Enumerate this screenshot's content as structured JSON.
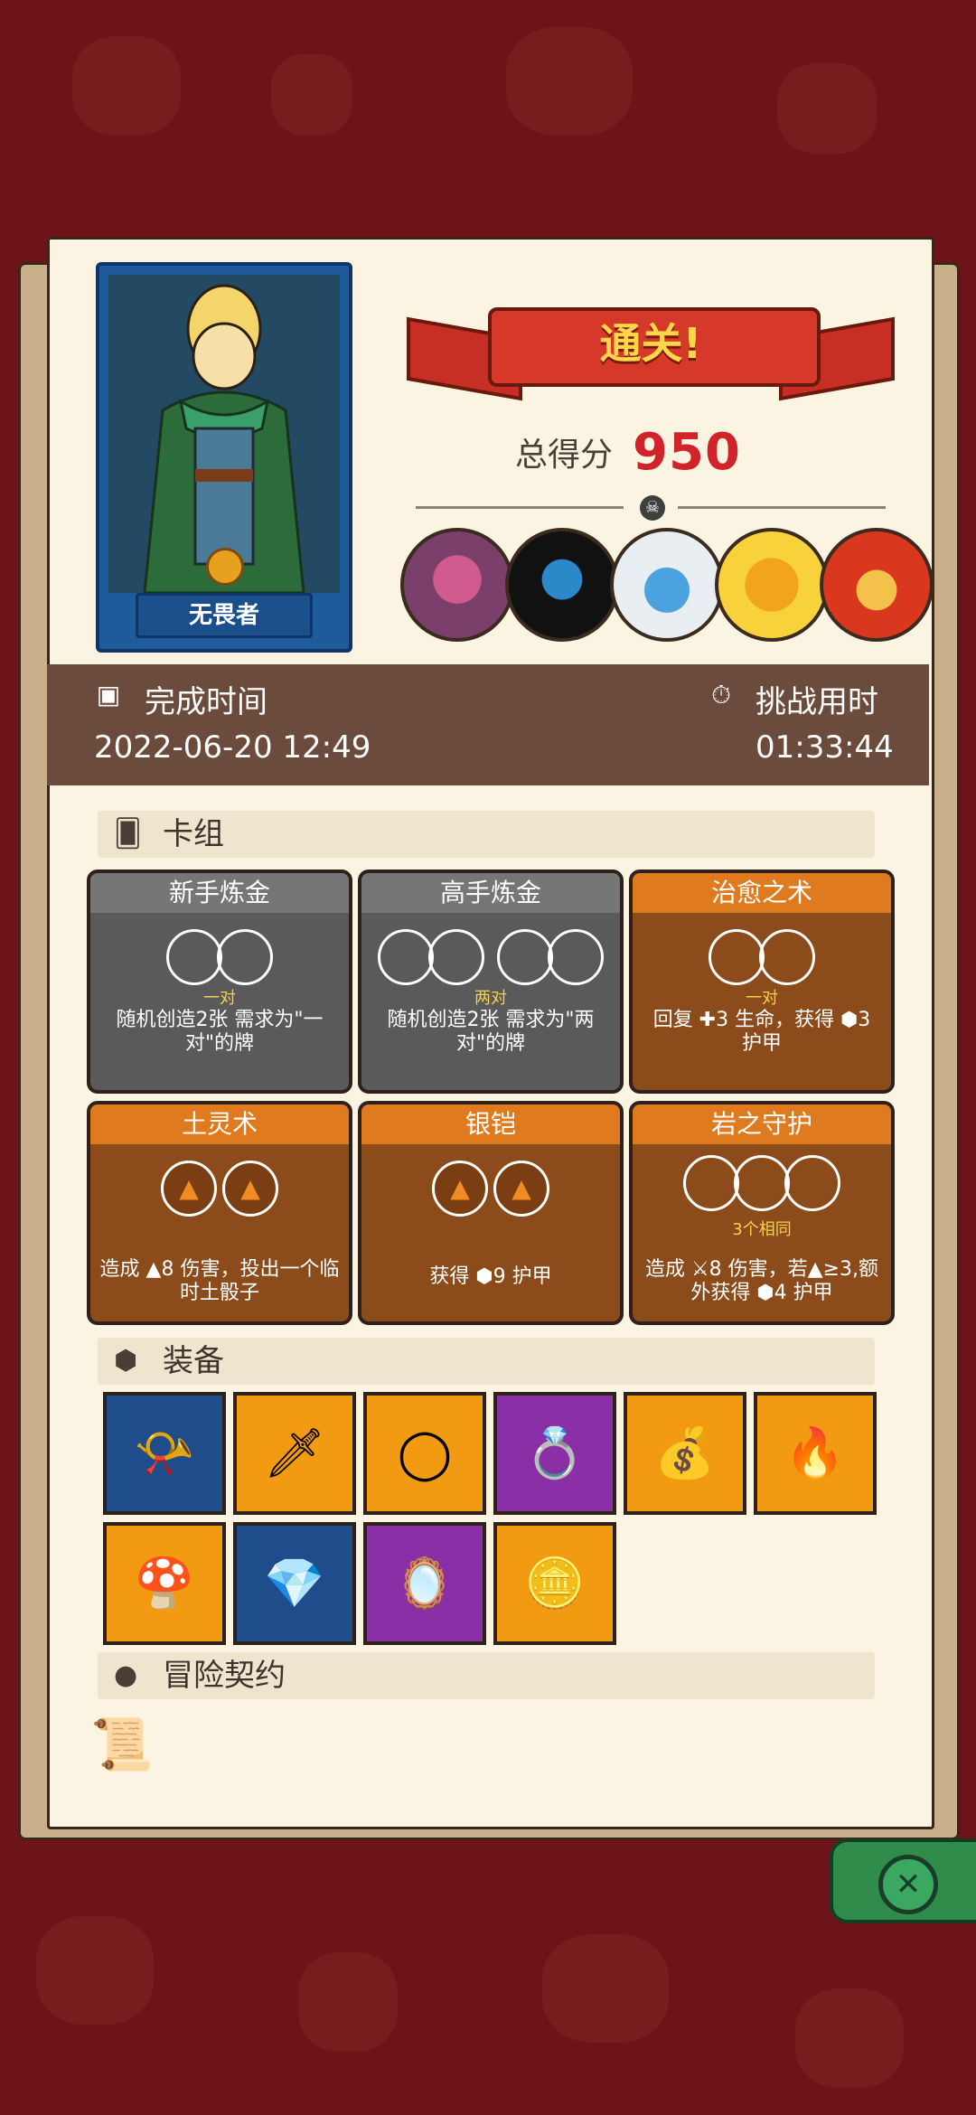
{
  "result": {
    "title": "通关!",
    "score_label": "总得分",
    "score_value": "950"
  },
  "hero": {
    "name": "无畏者"
  },
  "time": {
    "finish_label": "完成时间",
    "finish_value": "2022-06-20 12:49",
    "duration_label": "挑战用时",
    "duration_value": "01:33:44"
  },
  "sections": {
    "deck": "卡组",
    "equipment": "装备",
    "contract": "冒险契约"
  },
  "cards": [
    {
      "title": "新手炼金",
      "requirement": "一对",
      "desc": "随机创造2张 需求为\"一对\"的牌"
    },
    {
      "title": "高手炼金",
      "requirement": "两对",
      "desc": "随机创造2张 需求为\"两对\"的牌"
    },
    {
      "title": "治愈之术",
      "requirement": "一对",
      "desc": "回复 ✚3 生命，获得 ⬢3 护甲"
    },
    {
      "title": "土灵术",
      "requirement": "",
      "desc": "造成 ▲8 伤害，投出一个临时土骰子"
    },
    {
      "title": "银铠",
      "requirement": "",
      "desc": "获得 ⬢9 护甲"
    },
    {
      "title": "岩之守护",
      "requirement": "3个相同",
      "desc": "造成 ⚔8 伤害，若▲≥3,额外获得 ⬢4 护甲"
    }
  ],
  "equipment": [
    {
      "icon": "horn-icon",
      "color": "blue",
      "glyph": "📯"
    },
    {
      "icon": "crystal-blade-icon",
      "color": "orange",
      "glyph": "🗡"
    },
    {
      "icon": "ring-icon",
      "color": "orange",
      "glyph": "◯"
    },
    {
      "icon": "gem-ring-icon",
      "color": "purple",
      "glyph": "💍"
    },
    {
      "icon": "coin-sack-icon",
      "color": "orange",
      "glyph": "💰"
    },
    {
      "icon": "flame-cloth-icon",
      "color": "orange",
      "glyph": "🔥"
    },
    {
      "icon": "mushroom-icon",
      "color": "orange",
      "glyph": "🍄"
    },
    {
      "icon": "crystal-icon",
      "color": "blue",
      "glyph": "💎"
    },
    {
      "icon": "mirror-icon",
      "color": "purple",
      "glyph": "🪞"
    },
    {
      "icon": "gold-coin-icon",
      "color": "orange",
      "glyph": "🪙"
    }
  ],
  "colors": {
    "background": "#6e1418",
    "paper": "#fbf4e2",
    "band": "#6b4b3b",
    "score": "#d1232a",
    "card_gray": "#5a5a5a",
    "card_brown": "#8b4b1a",
    "card_header_orange": "#e07a1f"
  }
}
